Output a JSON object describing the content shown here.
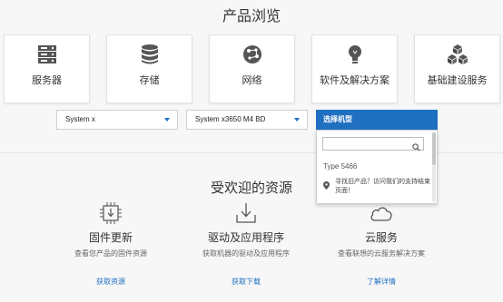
{
  "header": {
    "title": "产品浏览"
  },
  "categories": [
    {
      "label": "服务器",
      "icon": "server-icon"
    },
    {
      "label": "存储",
      "icon": "storage-icon"
    },
    {
      "label": "网络",
      "icon": "network-icon"
    },
    {
      "label": "软件及解决方案",
      "icon": "lightbulb-icon"
    },
    {
      "label": "基础建设服务",
      "icon": "cubes-icon"
    }
  ],
  "filters": {
    "family": "System x",
    "model": "System x3650 M4 BD",
    "machine_type_label": "选择机型"
  },
  "dropdown": {
    "search_placeholder": "",
    "items": [
      "Type 5466"
    ],
    "hint": "寻找旧产品？访问我们的支持结束页面！"
  },
  "resources": {
    "title": "受欢迎的资源",
    "items": [
      {
        "title": "固件更新",
        "desc": "查看您产品的固件资源",
        "link": "获取资源",
        "icon": "firmware-chip-icon"
      },
      {
        "title": "驱动及应用程序",
        "desc": "获取机器的驱动及应用程序",
        "link": "获取下载",
        "icon": "download-icon"
      },
      {
        "title": "云服务",
        "desc": "查看联想的云服务解决方案",
        "link": "了解详情",
        "icon": "cloud-icon"
      }
    ]
  },
  "colors": {
    "accent": "#1f70c1",
    "icon_gray": "#555555"
  }
}
